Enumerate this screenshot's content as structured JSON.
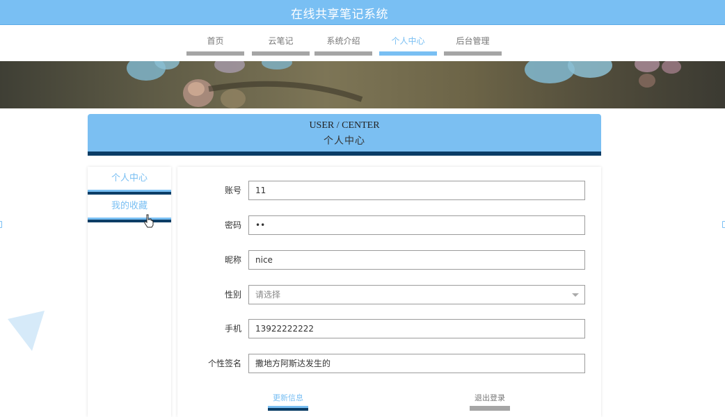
{
  "header": {
    "site_title": "在线共享笔记系统"
  },
  "nav": {
    "items": [
      {
        "label": "首页",
        "active": false
      },
      {
        "label": "云笔记",
        "active": false
      },
      {
        "label": "系统介绍",
        "active": false
      },
      {
        "label": "个人中心",
        "active": true
      },
      {
        "label": "后台管理",
        "active": false
      }
    ]
  },
  "user_center": {
    "title_en": "USER / CENTER",
    "title_cn": "个人中心"
  },
  "sidebar": {
    "items": [
      {
        "label": "个人中心"
      },
      {
        "label": "我的收藏"
      }
    ]
  },
  "form": {
    "account": {
      "label": "账号",
      "value": "11"
    },
    "password": {
      "label": "密码",
      "value": "••"
    },
    "nickname": {
      "label": "昵称",
      "value": "nice"
    },
    "gender": {
      "label": "性别",
      "placeholder": "请选择"
    },
    "phone": {
      "label": "手机",
      "value": "13922222222"
    },
    "signature": {
      "label": "个性签名",
      "value": "撒地方阿斯达发生的"
    }
  },
  "actions": {
    "update_label": "更新信息",
    "logout_label": "退出登录"
  },
  "colors": {
    "accent": "#79bff3",
    "dark_accent": "#0b3d66",
    "inactive_bar": "#a5a5a5"
  }
}
